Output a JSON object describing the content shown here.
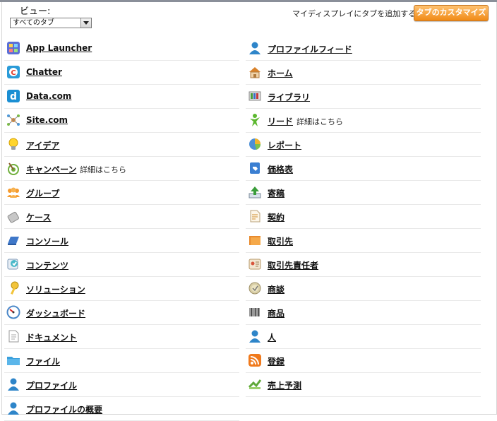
{
  "header": {
    "view_label": "ビュー:",
    "view_select_value": "すべてのタブ",
    "add_to_display_text": "マイディスプレイにタブを追加する",
    "customize_button": "タブのカスタマイズ"
  },
  "tabs_left": [
    {
      "label": "App Launcher",
      "icon": "app-launcher-icon"
    },
    {
      "label": "Chatter",
      "icon": "chatter-icon"
    },
    {
      "label": "Data.com",
      "icon": "data-com-icon"
    },
    {
      "label": "Site.com",
      "icon": "site-com-icon"
    },
    {
      "label": "アイデア",
      "icon": "lightbulb-icon"
    },
    {
      "label": "キャンペーン",
      "icon": "campaign-target-icon",
      "more": "詳細はこちら"
    },
    {
      "label": "グループ",
      "icon": "group-icon"
    },
    {
      "label": "ケース",
      "icon": "case-icon"
    },
    {
      "label": "コンソール",
      "icon": "console-icon"
    },
    {
      "label": "コンテンツ",
      "icon": "content-icon"
    },
    {
      "label": "ソリューション",
      "icon": "solution-key-icon"
    },
    {
      "label": "ダッシュボード",
      "icon": "dashboard-gauge-icon"
    },
    {
      "label": "ドキュメント",
      "icon": "document-icon"
    },
    {
      "label": "ファイル",
      "icon": "file-folder-icon"
    },
    {
      "label": "プロファイル",
      "icon": "person-icon"
    },
    {
      "label": "プロファイルの概要",
      "icon": "person-icon"
    }
  ],
  "tabs_right": [
    {
      "label": "プロファイルフィード",
      "icon": "person-icon"
    },
    {
      "label": "ホーム",
      "icon": "home-icon"
    },
    {
      "label": "ライブラリ",
      "icon": "library-icon"
    },
    {
      "label": "リード",
      "icon": "lead-icon",
      "more": "詳細はこちら"
    },
    {
      "label": "レポート",
      "icon": "report-chart-icon"
    },
    {
      "label": "価格表",
      "icon": "pricebook-icon"
    },
    {
      "label": "寄稿",
      "icon": "upload-arrow-icon"
    },
    {
      "label": "契約",
      "icon": "contract-icon"
    },
    {
      "label": "取引先",
      "icon": "account-folder-icon"
    },
    {
      "label": "取引先責任者",
      "icon": "contact-card-icon"
    },
    {
      "label": "商談",
      "icon": "opportunity-coin-icon"
    },
    {
      "label": "商品",
      "icon": "barcode-icon"
    },
    {
      "label": "人",
      "icon": "person-icon"
    },
    {
      "label": "登録",
      "icon": "rss-icon"
    },
    {
      "label": "売上予測",
      "icon": "forecast-icon"
    }
  ]
}
